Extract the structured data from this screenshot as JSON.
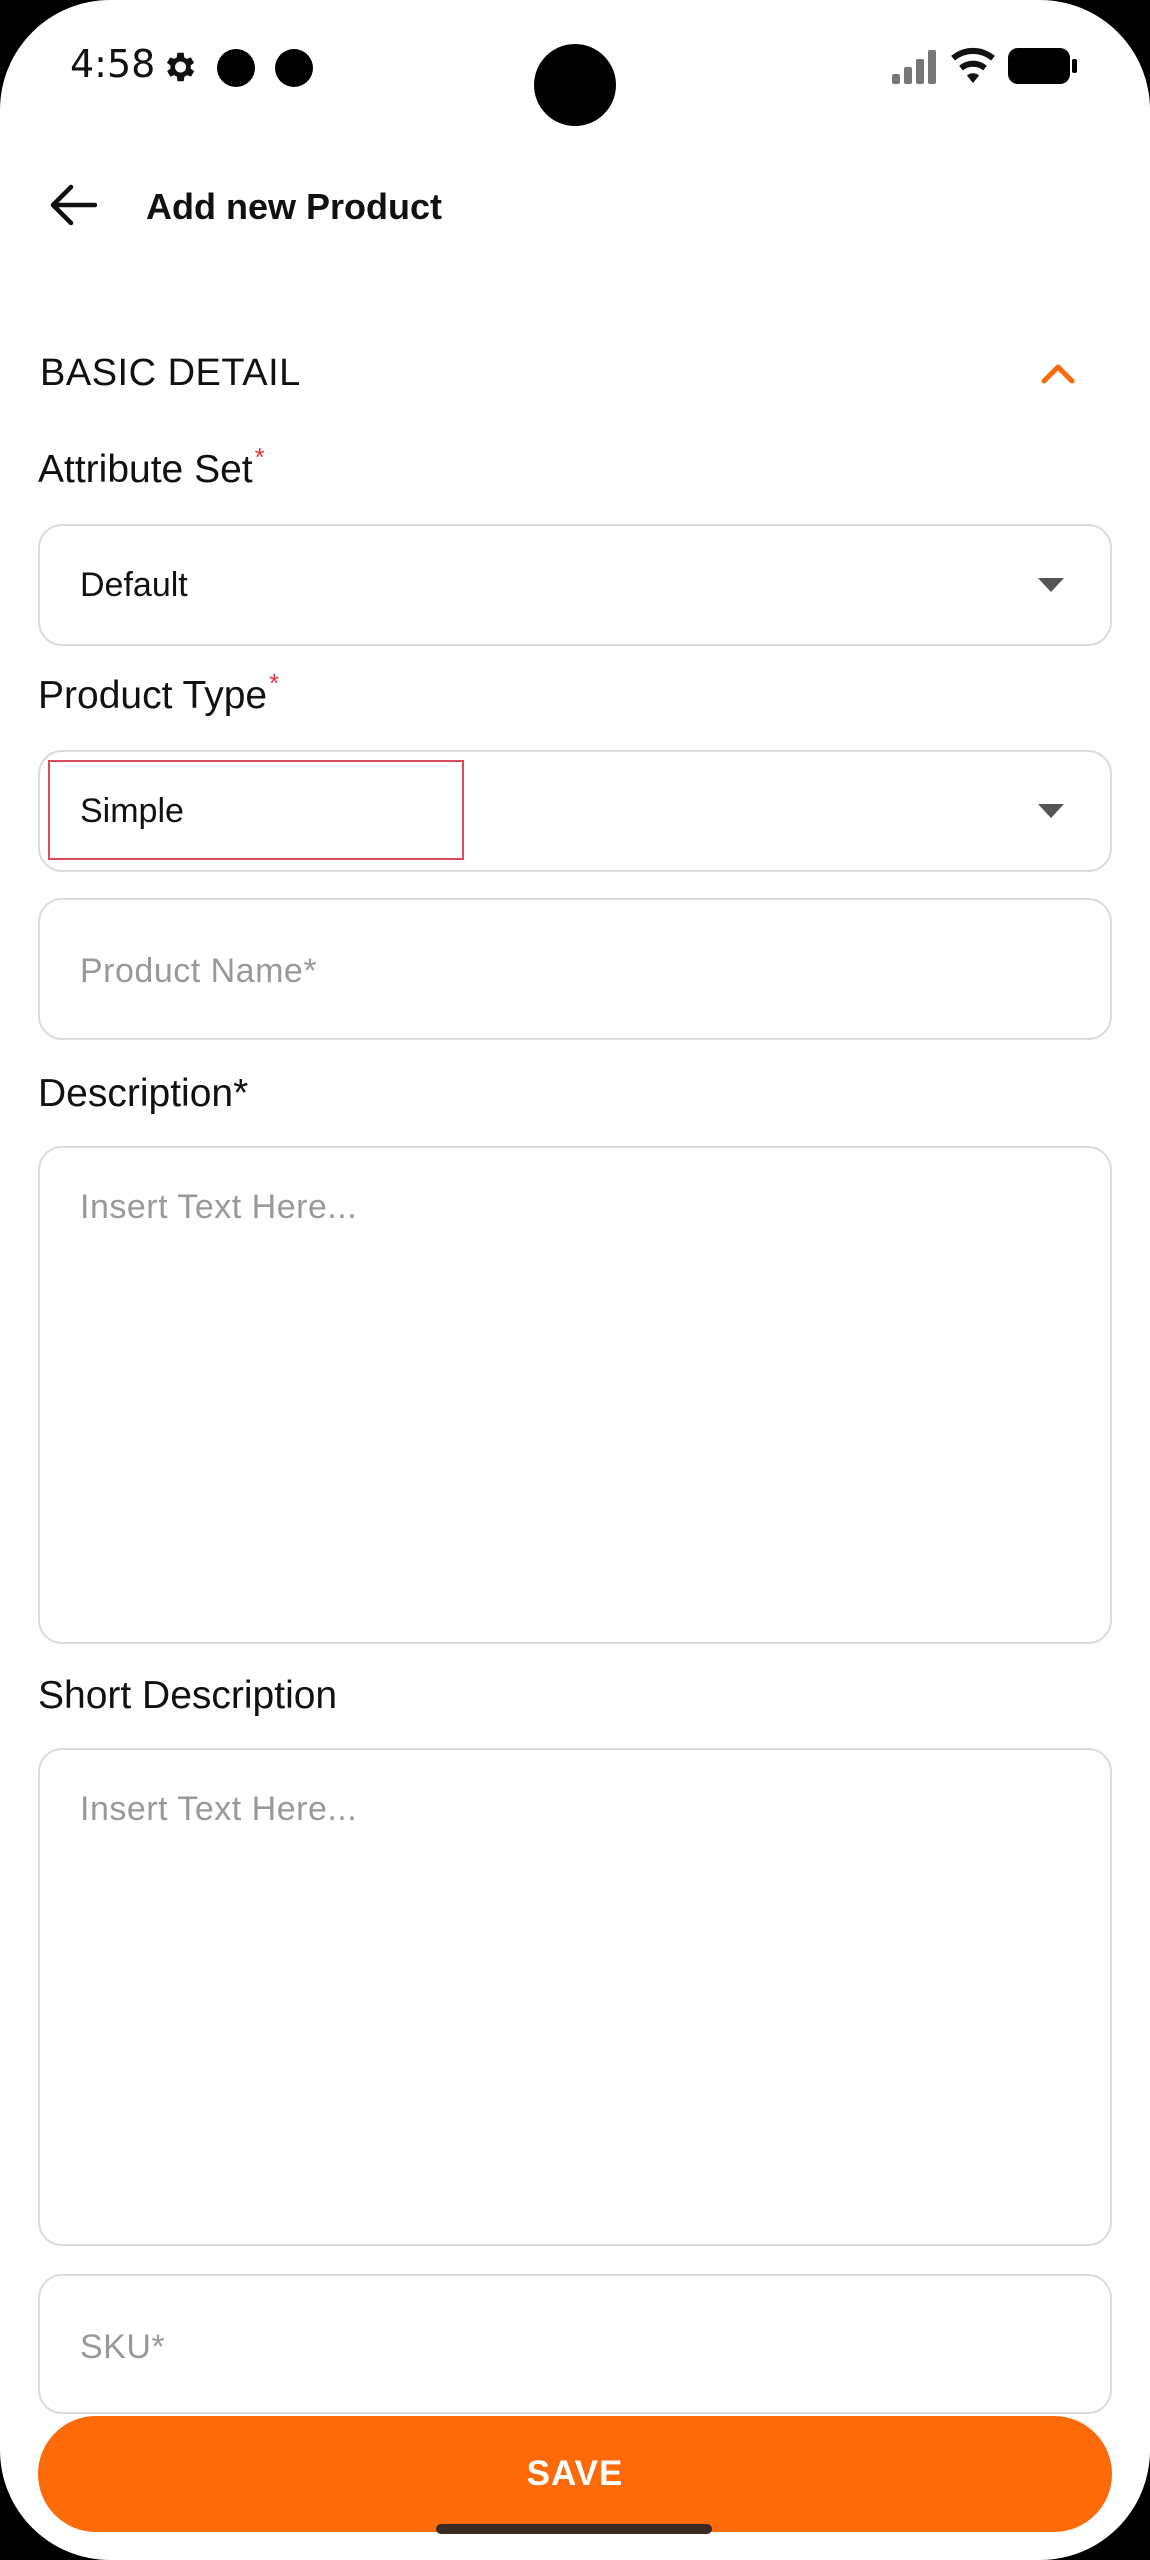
{
  "status_bar": {
    "time": "4:58",
    "icons": [
      "gear-icon",
      "dot-icon",
      "dot-icon",
      "signal-icon",
      "wifi-icon",
      "battery-icon"
    ]
  },
  "header": {
    "back_icon": "arrow-left-icon",
    "title": "Add new Product"
  },
  "section": {
    "title": "BASIC DETAIL",
    "collapse_icon": "chevron-up-icon",
    "accent_color": "#fd6a0a"
  },
  "form": {
    "attribute_set": {
      "label": "Attribute Set",
      "required_mark": "*",
      "value": "Default"
    },
    "product_type": {
      "label": "Product Type",
      "required_mark": "*",
      "value": "Simple"
    },
    "product_name": {
      "placeholder": "Product Name*"
    },
    "description": {
      "label": "Description*",
      "placeholder": "Insert Text Here..."
    },
    "short_description": {
      "label": "Short Description",
      "placeholder": "Insert Text Here..."
    },
    "sku": {
      "placeholder": "SKU*"
    }
  },
  "actions": {
    "save_label": "SAVE",
    "save_color": "#fd6a0a"
  }
}
